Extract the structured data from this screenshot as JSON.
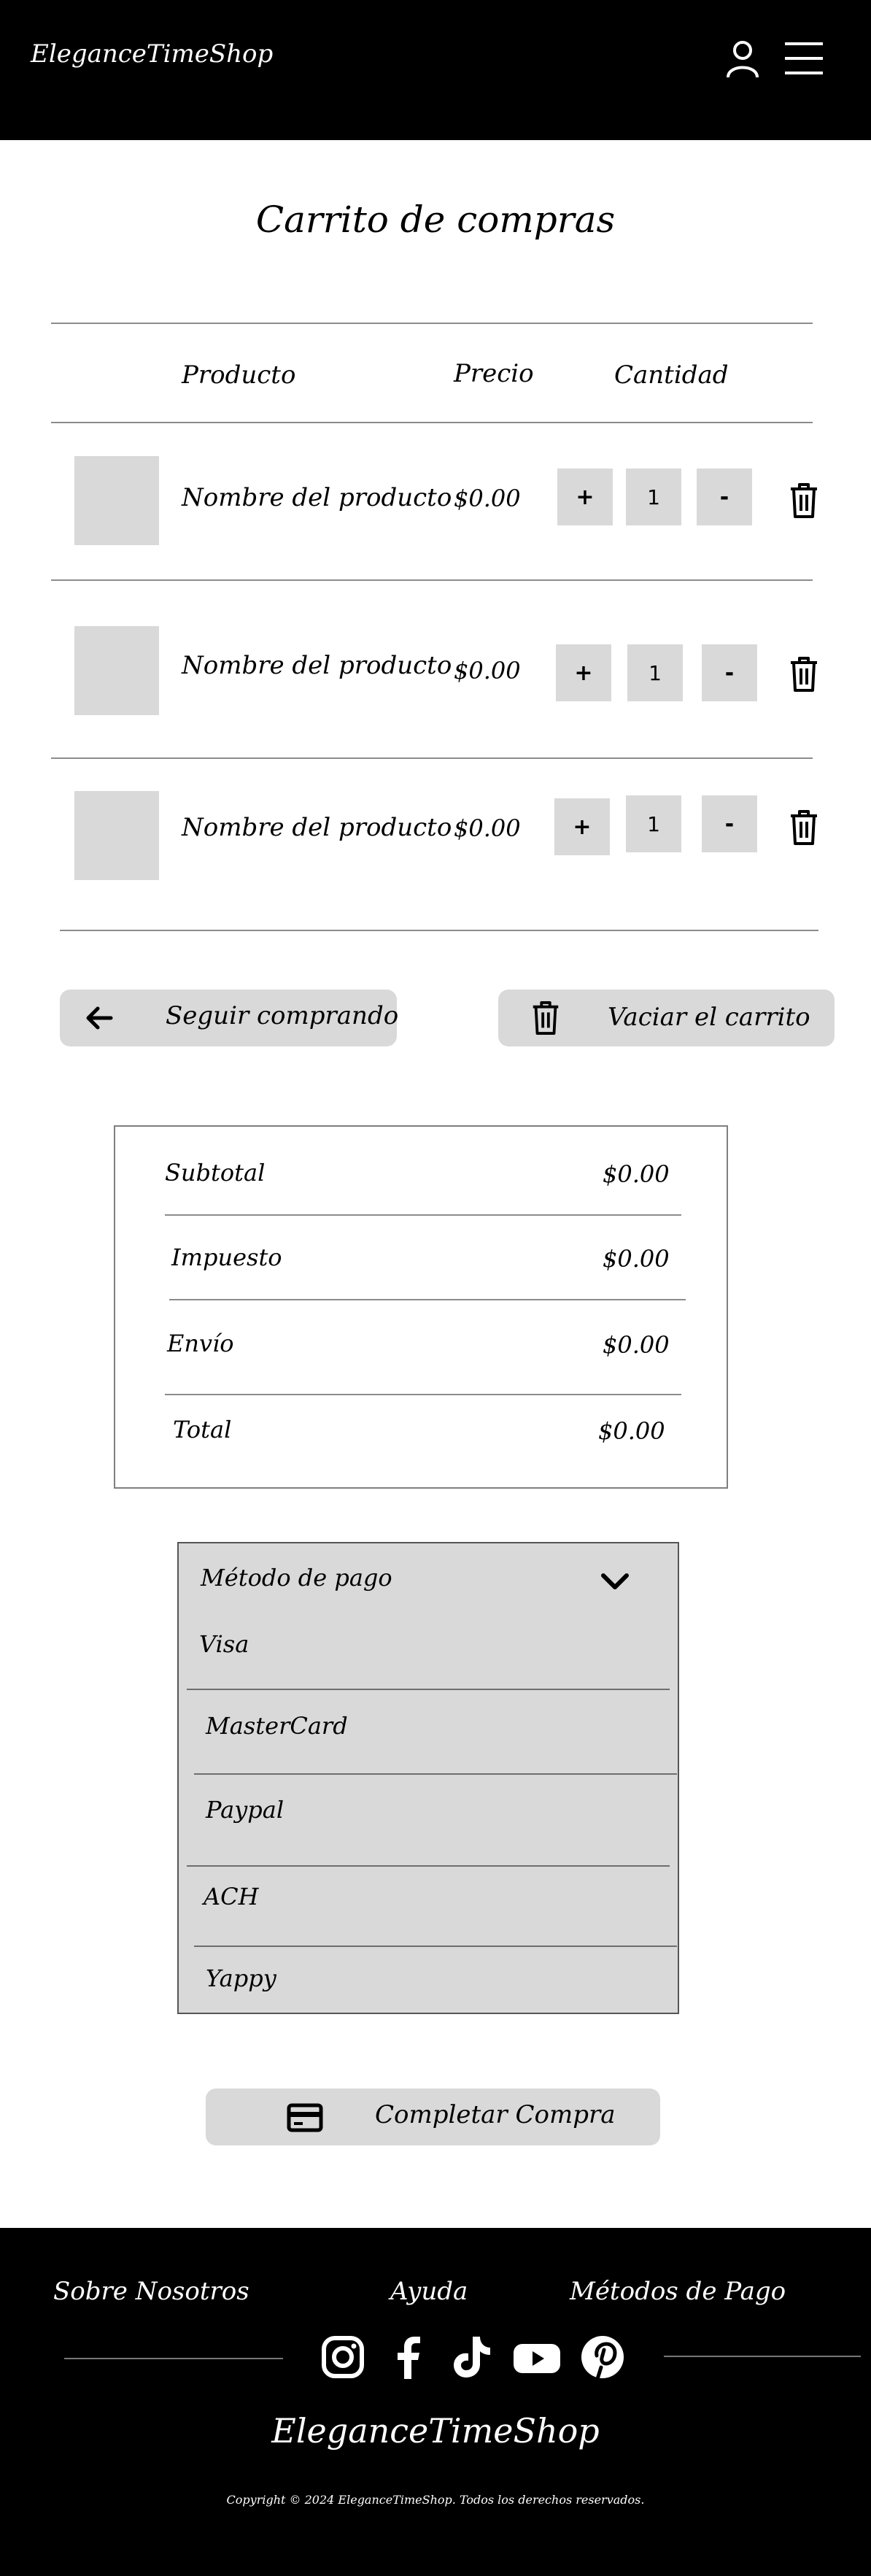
{
  "header": {
    "brand": "EleganceTimeShop",
    "icons": [
      "user-icon",
      "menu-icon"
    ]
  },
  "page": {
    "title": "Carrito de compras"
  },
  "cart": {
    "columns": {
      "product": "Producto",
      "price": "Precio",
      "quantity": "Cantidad"
    },
    "items": [
      {
        "name": "Nombre del producto",
        "price": "$0.00",
        "quantity": "1",
        "plus": "+",
        "minus": "-"
      },
      {
        "name": "Nombre del producto",
        "price": "$0.00",
        "quantity": "1",
        "plus": "+",
        "minus": "-"
      },
      {
        "name": "Nombre del producto",
        "price": "$0.00",
        "quantity": "1",
        "plus": "+",
        "minus": "-"
      }
    ]
  },
  "actions": {
    "continue_label": "Seguir comprando",
    "clear_label": "Vaciar el carrito"
  },
  "summary": {
    "rows": [
      {
        "label": "Subtotal",
        "value": "$0.00"
      },
      {
        "label": "Impuesto",
        "value": "$0.00"
      },
      {
        "label": "Envío",
        "value": "$0.00"
      },
      {
        "label": "Total",
        "value": "$0.00"
      }
    ]
  },
  "payment": {
    "label": "Método de pago",
    "options": [
      "Visa",
      "MasterCard",
      "Paypal",
      "ACH",
      "Yappy"
    ]
  },
  "checkout": {
    "label": "Completar Compra"
  },
  "footer": {
    "links": [
      "Sobre Nosotros",
      "Ayuda",
      "Métodos de Pago"
    ],
    "social": [
      "instagram-icon",
      "facebook-icon",
      "tiktok-icon",
      "youtube-icon",
      "pinterest-icon"
    ],
    "brand": "EleganceTimeShop",
    "copyright": "Copyright © 2024 EleganceTimeShop. Todos los derechos reservados."
  },
  "colors": {
    "header_bg": "#000000",
    "button_bg": "#d9d9d9",
    "footer_bg": "#000000"
  }
}
